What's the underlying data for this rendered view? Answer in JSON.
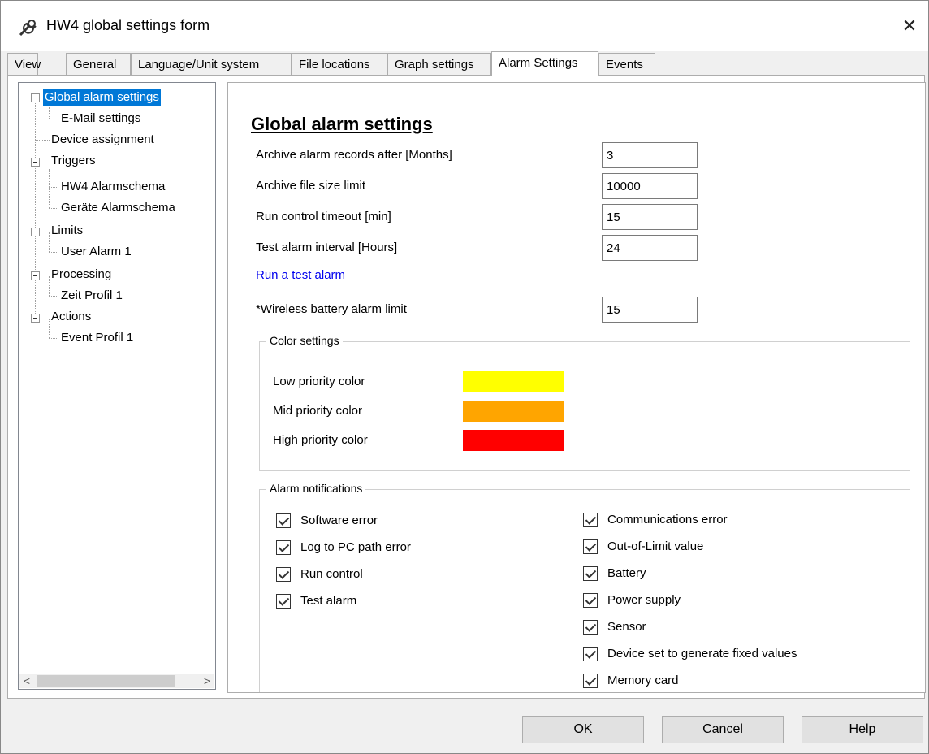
{
  "window": {
    "title": "HW4 global settings form",
    "title_icon": "wrench-icon",
    "close_glyph": "✕"
  },
  "tabs": [
    {
      "label": "View"
    },
    {
      "label": "General"
    },
    {
      "label": "Language/Unit system"
    },
    {
      "label": "File locations"
    },
    {
      "label": "Graph settings"
    },
    {
      "label": "Alarm Settings",
      "active": true
    },
    {
      "label": "Events"
    }
  ],
  "tree": {
    "items": [
      {
        "label": "Global alarm settings",
        "selected": true
      },
      {
        "label": "E-Mail settings"
      },
      {
        "label": "Device assignment"
      },
      {
        "label": "Triggers"
      },
      {
        "label": "HW4 Alarmschema"
      },
      {
        "label": "Geräte Alarmschema"
      },
      {
        "label": "Limits"
      },
      {
        "label": "User Alarm 1"
      },
      {
        "label": "Processing"
      },
      {
        "label": "Zeit Profil 1"
      },
      {
        "label": "Actions"
      },
      {
        "label": "Event Profil 1"
      }
    ],
    "scroll_left": "<",
    "scroll_right": ">"
  },
  "content": {
    "heading": "Global alarm settings",
    "fields": [
      {
        "label": "Archive alarm records after [Months]",
        "value": "3"
      },
      {
        "label": "Archive file size limit",
        "value": "10000"
      },
      {
        "label": "Run control timeout [min]",
        "value": "15"
      },
      {
        "label": "Test alarm interval [Hours]",
        "value": "24"
      }
    ],
    "test_link": "Run a test alarm",
    "wireless": {
      "label": "*Wireless battery alarm limit",
      "value": "15"
    },
    "color_settings": {
      "legend": "Color settings",
      "items": [
        {
          "label": "Low priority color",
          "color": "#ffff00"
        },
        {
          "label": "Mid priority color",
          "color": "#ffa500"
        },
        {
          "label": "High priority color",
          "color": "#ff0000"
        }
      ]
    },
    "notifications": {
      "legend": "Alarm notifications",
      "left": [
        {
          "label": "Software error",
          "checked": true
        },
        {
          "label": "Log to PC path error",
          "checked": true
        },
        {
          "label": "Run control",
          "checked": true
        },
        {
          "label": "Test alarm",
          "checked": true
        }
      ],
      "right": [
        {
          "label": "Communications error",
          "checked": true
        },
        {
          "label": "Out-of-Limit value",
          "checked": true
        },
        {
          "label": "Battery",
          "checked": true
        },
        {
          "label": "Power supply",
          "checked": true
        },
        {
          "label": "Sensor",
          "checked": true
        },
        {
          "label": "Device set to generate fixed values",
          "checked": true
        },
        {
          "label": "Memory card",
          "checked": true
        }
      ]
    }
  },
  "buttons": {
    "ok": "OK",
    "cancel": "Cancel",
    "help": "Help"
  }
}
